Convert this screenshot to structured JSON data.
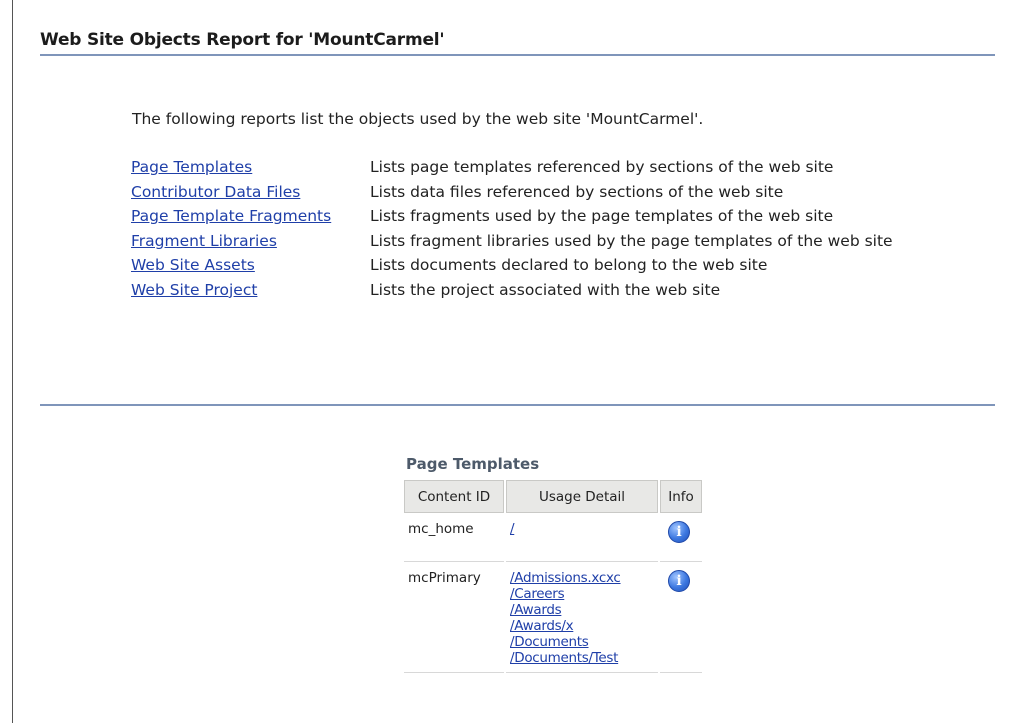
{
  "page_title": "Web Site Objects Report for 'MountCarmel'",
  "intro": "The following reports list the objects used by the web site 'MountCarmel'.",
  "reports": [
    {
      "link": "Page Templates",
      "desc": "Lists page templates referenced by sections of the web site"
    },
    {
      "link": "Contributor Data Files",
      "desc": "Lists data files referenced by sections of the web site"
    },
    {
      "link": "Page Template Fragments",
      "desc": "Lists fragments used by the page templates of the web site"
    },
    {
      "link": "Fragment Libraries",
      "desc": "Lists fragment libraries used by the page templates of the web site"
    },
    {
      "link": "Web Site Assets",
      "desc": "Lists documents declared to belong to the web site"
    },
    {
      "link": "Web Site Project",
      "desc": "Lists the project associated with the web site"
    }
  ],
  "page_templates": {
    "title": "Page Templates",
    "columns": [
      "Content ID",
      "Usage Detail",
      "Info"
    ],
    "rows": [
      {
        "content_id": "mc_home",
        "usage": [
          "/"
        ],
        "info_icon": "info-icon"
      },
      {
        "content_id": "mcPrimary",
        "usage": [
          "/Admissions.xcxc",
          "/Careers",
          "/Awards",
          "/Awards/x",
          "/Documents",
          "/Documents/Test"
        ],
        "info_icon": "info-icon"
      }
    ]
  },
  "colors": {
    "link": "#1f3fa8",
    "rule": "#7f95ba",
    "header_bg": "#e8e8e6"
  }
}
